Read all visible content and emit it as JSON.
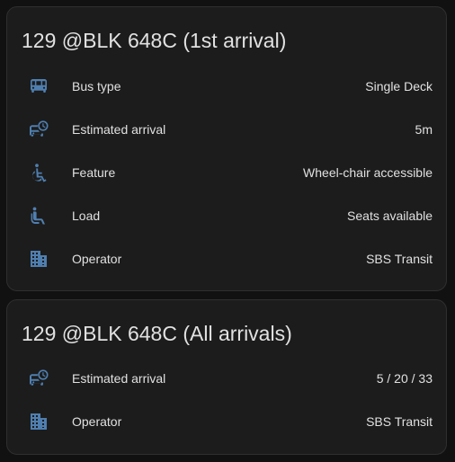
{
  "accent_color": "#4f7fb0",
  "cards": [
    {
      "title": "129 @BLK 648C (1st arrival)",
      "rows": [
        {
          "icon": "bus-icon",
          "label": "Bus type",
          "value": "Single Deck"
        },
        {
          "icon": "bus-clock-icon",
          "label": "Estimated arrival",
          "value": "5m"
        },
        {
          "icon": "wheelchair-icon",
          "label": "Feature",
          "value": "Wheel-chair accessible"
        },
        {
          "icon": "seat-passenger-icon",
          "label": "Load",
          "value": "Seats available"
        },
        {
          "icon": "office-building-icon",
          "label": "Operator",
          "value": "SBS Transit"
        }
      ]
    },
    {
      "title": "129 @BLK 648C (All arrivals)",
      "rows": [
        {
          "icon": "bus-clock-icon",
          "label": "Estimated arrival",
          "value": "5 / 20 / 33"
        },
        {
          "icon": "office-building-icon",
          "label": "Operator",
          "value": "SBS Transit"
        }
      ]
    }
  ]
}
